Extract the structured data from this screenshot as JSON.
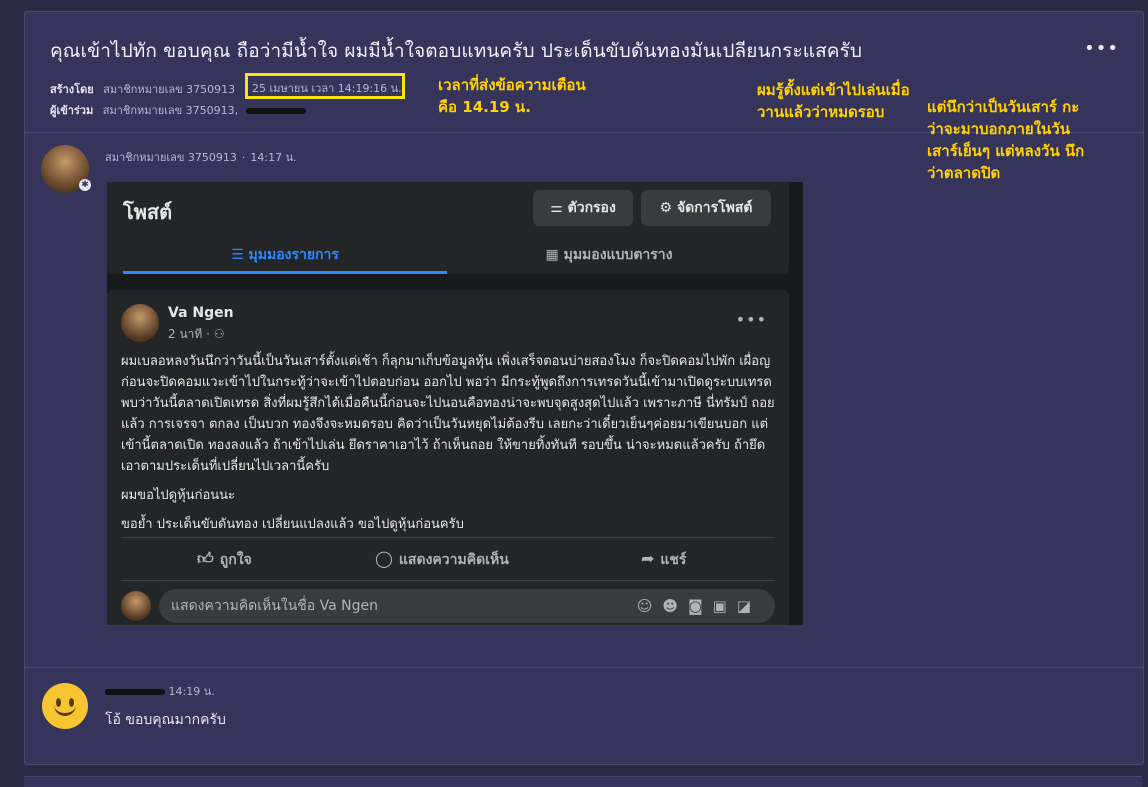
{
  "thread": {
    "title": "คุณเข้าไปทัก ขอบคุณ ถือว่ามีน้ำใจ ผมมีน้ำใจตอบแทนครับ ประเด็นขับดันทองมันเปลียนกระแสครับ",
    "more_label": "•••",
    "created_by_label": "สร้างโดย",
    "created_by_user": "สมาชิกหมายเลข 3750913",
    "created_at": "25 เมษายน เวลา 14:19:16 น.",
    "participants_label": "ผู้เข้าร่วม",
    "participants_value": "สมาชิกหมายเลข 3750913,"
  },
  "annotations": {
    "a1_line1": "เวลาที่ส่งข้อความเตือน",
    "a1_line2": "คือ 14.19 น.",
    "a2_line1": "ผมรู้ตั้งแต่เข้าไปเล่นเมื่อ",
    "a2_line2": "วานแล้วว่าหมดรอบ",
    "a3_line1": "แต่นึกว่าเป็นวันเสาร์ กะ",
    "a3_line2": "ว่าจะมาบอกภายในวัน",
    "a3_line3": "เสาร์เย็นๆ แต่หลงวัน นึก",
    "a3_line4": "ว่าตลาดปิด"
  },
  "post": {
    "author": "สมาชิกหมายเลข 3750913",
    "time": "14:17 น."
  },
  "fb": {
    "title": "โพสต์",
    "filter_label": "ตัวกรอง",
    "manage_label": "จัดการโพสต์",
    "tab_list": "มุมมองรายการ",
    "tab_grid": "มุมมองแบบตาราง",
    "author": "Va Ngen",
    "time": "2 นาที",
    "body_p1": "ผมเบลอหลงวันนึกว่าวันนี้เป็นวันเสาร์ตั้งแต่เช้า ก็ลุกมาเก็บข้อมูลหุ้น เพิ่งเสร็จตอนบ่ายสองโมง ก็จะปิดคอมไปพัก เผื่อญ ก่อนจะปิดคอมแวะเข้าไปในกระทู้ว่าจะเข้าไปตอบก่อน ออกไป พอว่า มีกระทู้พูดถึงการเทรดวันนี้เข้ามาเปิดดูระบบเทรดพบว่าวันนี้ตลาดเปิดเทรด สิ่งที่ผมรู้สึกได้เมื่อคืนนี้ก่อนจะไปนอนคือทองน่าจะพบจุดสูงสุดไปแล้ว เพราะภาษี นี่ทรัมป์ ถอยแล้ว การเจรจา ตกลง เป็นบวก ทองจึงจะหมดรอบ คิดว่าเป็นวันหยุดไม่ต้องรีบ เลยกะว่าเดี๋ยวเย็นๆค่อยมาเขียนบอก แต่เข้านี้ตลาดเปิด ทองลงแล้ว ถ้าเข้าไปเล่น ยึดราคาเอาไว้ ถ้าเห็นถอย ให้ขายทิ้งทันที รอบขึ้น น่าจะหมดแล้วครับ ถ้ายึดเอาตามประเด็นที่เปลี่ยนไปเวลานี้ครับ",
    "body_p2": "ผมขอไปดูหุ้นก่อนนะ",
    "body_p3": "ขอย้ำ ประเด็นขับดันทอง เปลี่ยนแปลงแล้ว ขอไปดูหุ้นก่อนครับ",
    "like_label": "ถูกใจ",
    "comment_label": "แสดงความคิดเห็น",
    "share_label": "แชร์",
    "comment_placeholder": "แสดงความคิดเห็นในชื่อ Va Ngen"
  },
  "reply": {
    "time": "14:19 น.",
    "text": "โอ้ ขอบคุณมากครับ"
  },
  "colors": {
    "page_bg": "#2b2a45",
    "card_bg": "#36345a",
    "highlight": "#f5e614",
    "annotation": "#ffd200",
    "fb_bg": "#18191a",
    "fb_card": "#242526",
    "fb_accent": "#2d88ff"
  }
}
